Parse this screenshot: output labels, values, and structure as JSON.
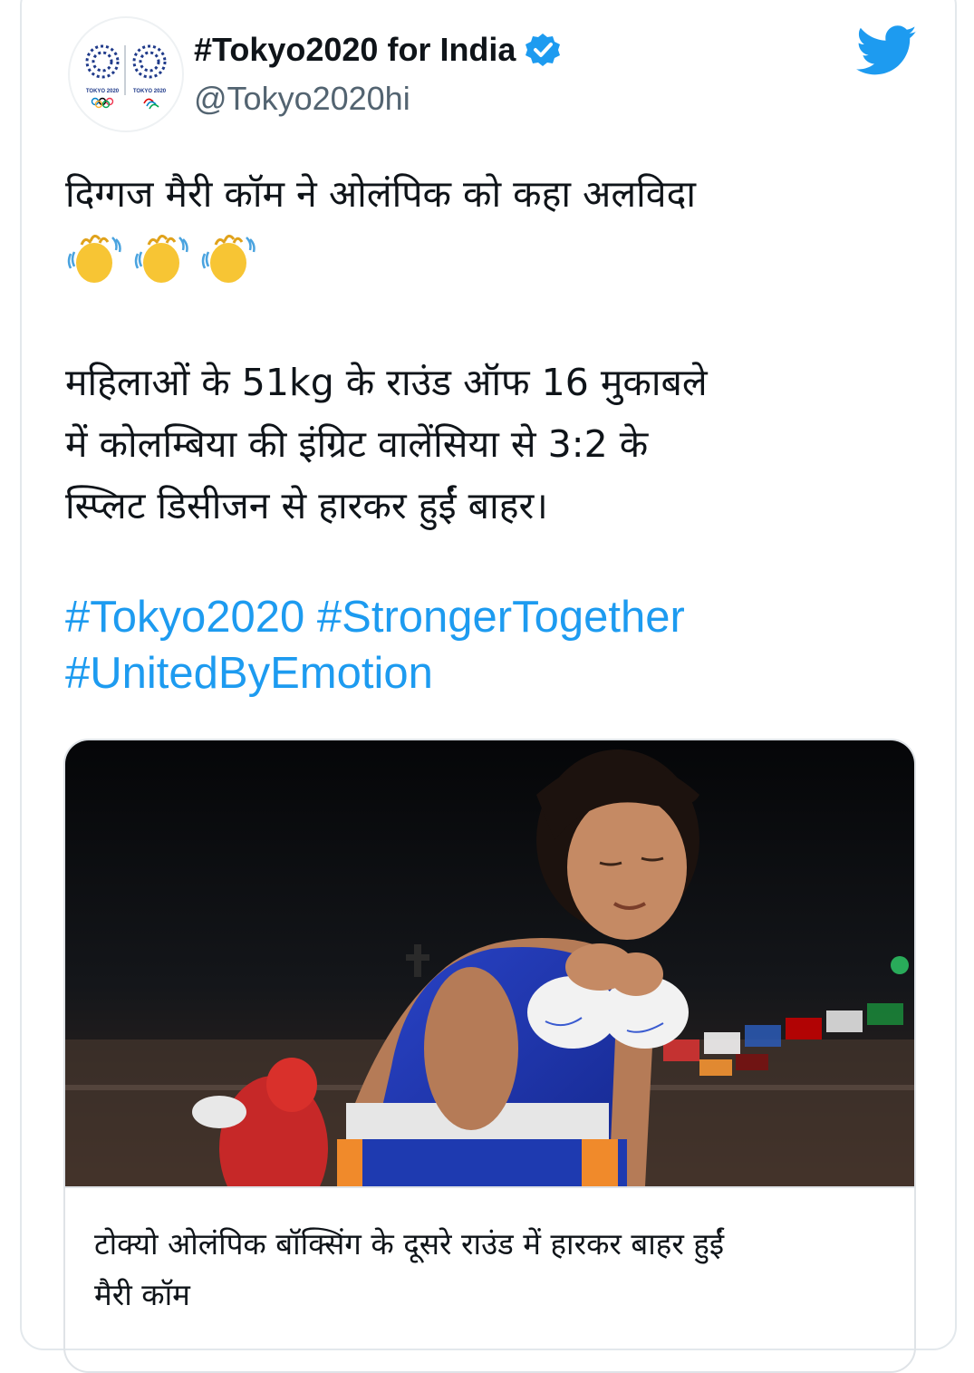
{
  "account": {
    "display_name": "#Tokyo2020 for India",
    "handle": "@Tokyo2020hi",
    "verified": true,
    "avatar_logo_text_left": "TOKYO 2020",
    "avatar_logo_text_right": "TOKYO 2020"
  },
  "tweet": {
    "line1": "दिग्गज मैरी कॉम ने ओलंपिक को कहा अलविदा",
    "emojis": [
      "waving-hands",
      "waving-hands",
      "waving-hands"
    ],
    "para2_line1": "महिलाओं के 51kg के राउंड ऑफ 16 मुकाबले",
    "para2_line2": "में कोलम्बिया की इंग्रिट वालेंसिया से 3:2 के",
    "para2_line3": "स्प्लिट डिसीजन से हारकर हुईं बाहर।",
    "hashtags": [
      "#Tokyo2020",
      "#StrongerTogether",
      "#UnitedByEmotion"
    ]
  },
  "link_card": {
    "title_line1": "टोक्यो ओलंपिक बॉक्सिंग के दूसरे राउंड में हारकर बाहर हुईं",
    "title_line2": "मैरी कॉम"
  },
  "colors": {
    "link": "#1d9bf0",
    "twitter_blue": "#1d9bf0",
    "text": "#0f1419",
    "muted": "#536471"
  },
  "icons": {
    "verified": "verified-badge-icon",
    "brand": "twitter-bird-icon"
  }
}
